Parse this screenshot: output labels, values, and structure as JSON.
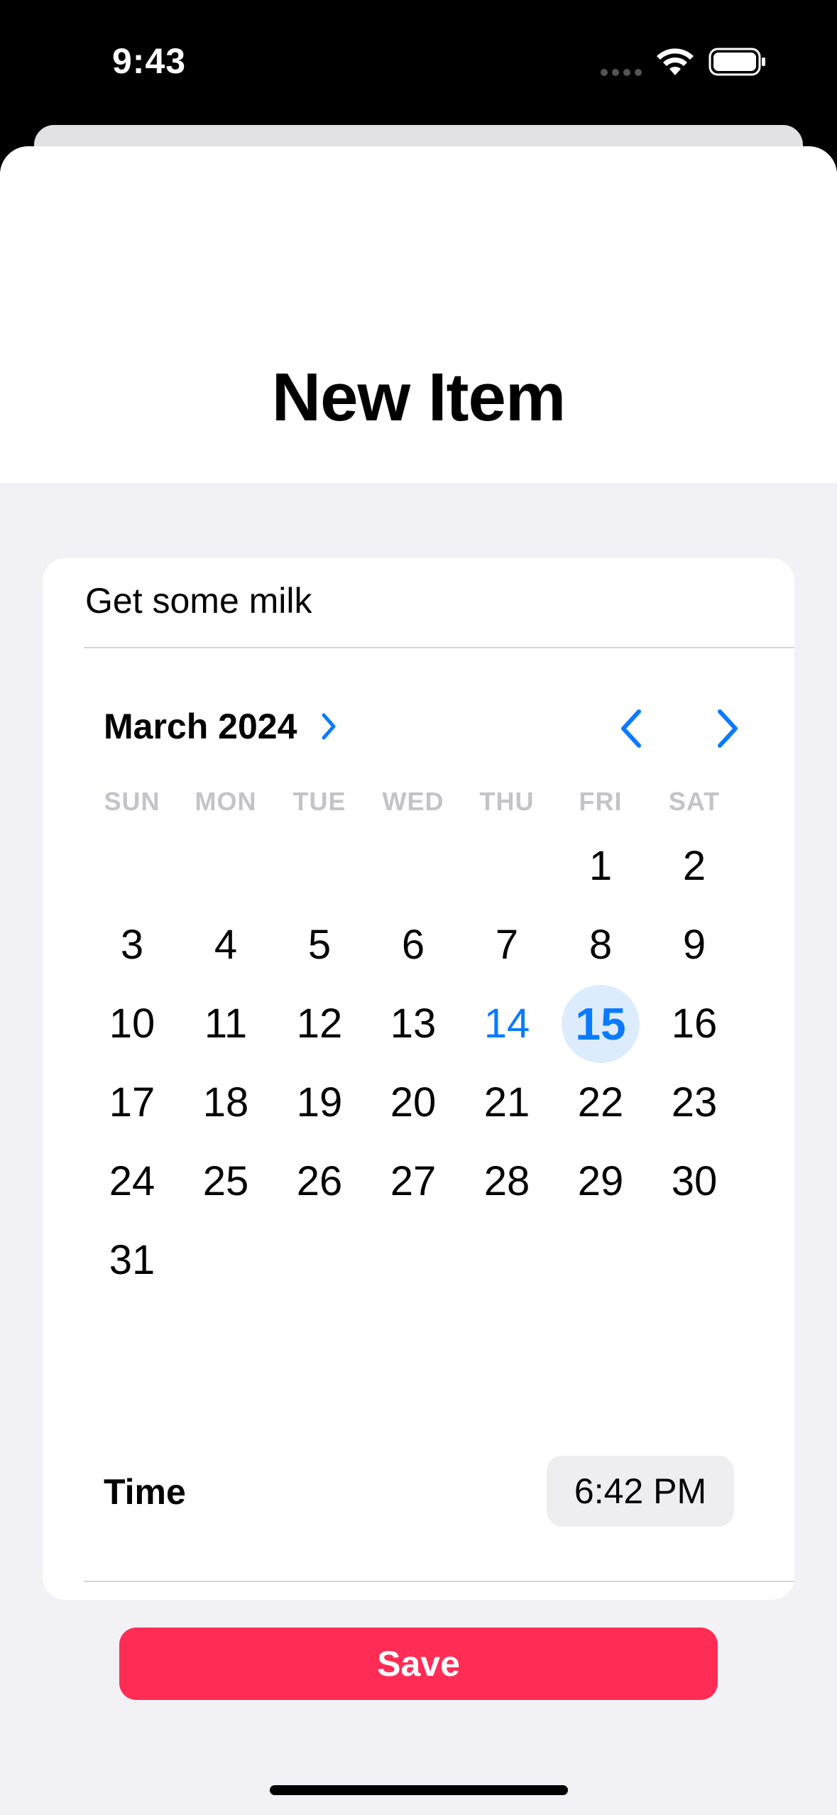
{
  "status_bar": {
    "time": "9:43"
  },
  "sheet": {
    "title": "New Item"
  },
  "form": {
    "item_text": "Get some milk",
    "calendar": {
      "month_label": "March 2024",
      "weekdays": [
        "SUN",
        "MON",
        "TUE",
        "WED",
        "THU",
        "FRI",
        "SAT"
      ],
      "days": [
        "1",
        "2",
        "3",
        "4",
        "5",
        "6",
        "7",
        "8",
        "9",
        "10",
        "11",
        "12",
        "13",
        "14",
        "15",
        "16",
        "17",
        "18",
        "19",
        "20",
        "21",
        "22",
        "23",
        "24",
        "25",
        "26",
        "27",
        "28",
        "29",
        "30",
        "31"
      ],
      "first_weekday_index": 5,
      "today": "14",
      "selected": "15"
    },
    "time_label": "Time",
    "time_value": "6:42 PM",
    "save_label": "Save"
  },
  "colors": {
    "accent": "#0a7aff",
    "save_button": "#ff2d55",
    "selected_day_bg": "#ddecfd",
    "background": "#f1f1f6"
  },
  "icons": {
    "signal": "cellular-signal-icon",
    "wifi": "wifi-icon",
    "battery": "battery-icon",
    "month_disclosure": "chevron-right-icon",
    "prev_month": "chevron-left-icon",
    "next_month": "chevron-right-icon"
  }
}
